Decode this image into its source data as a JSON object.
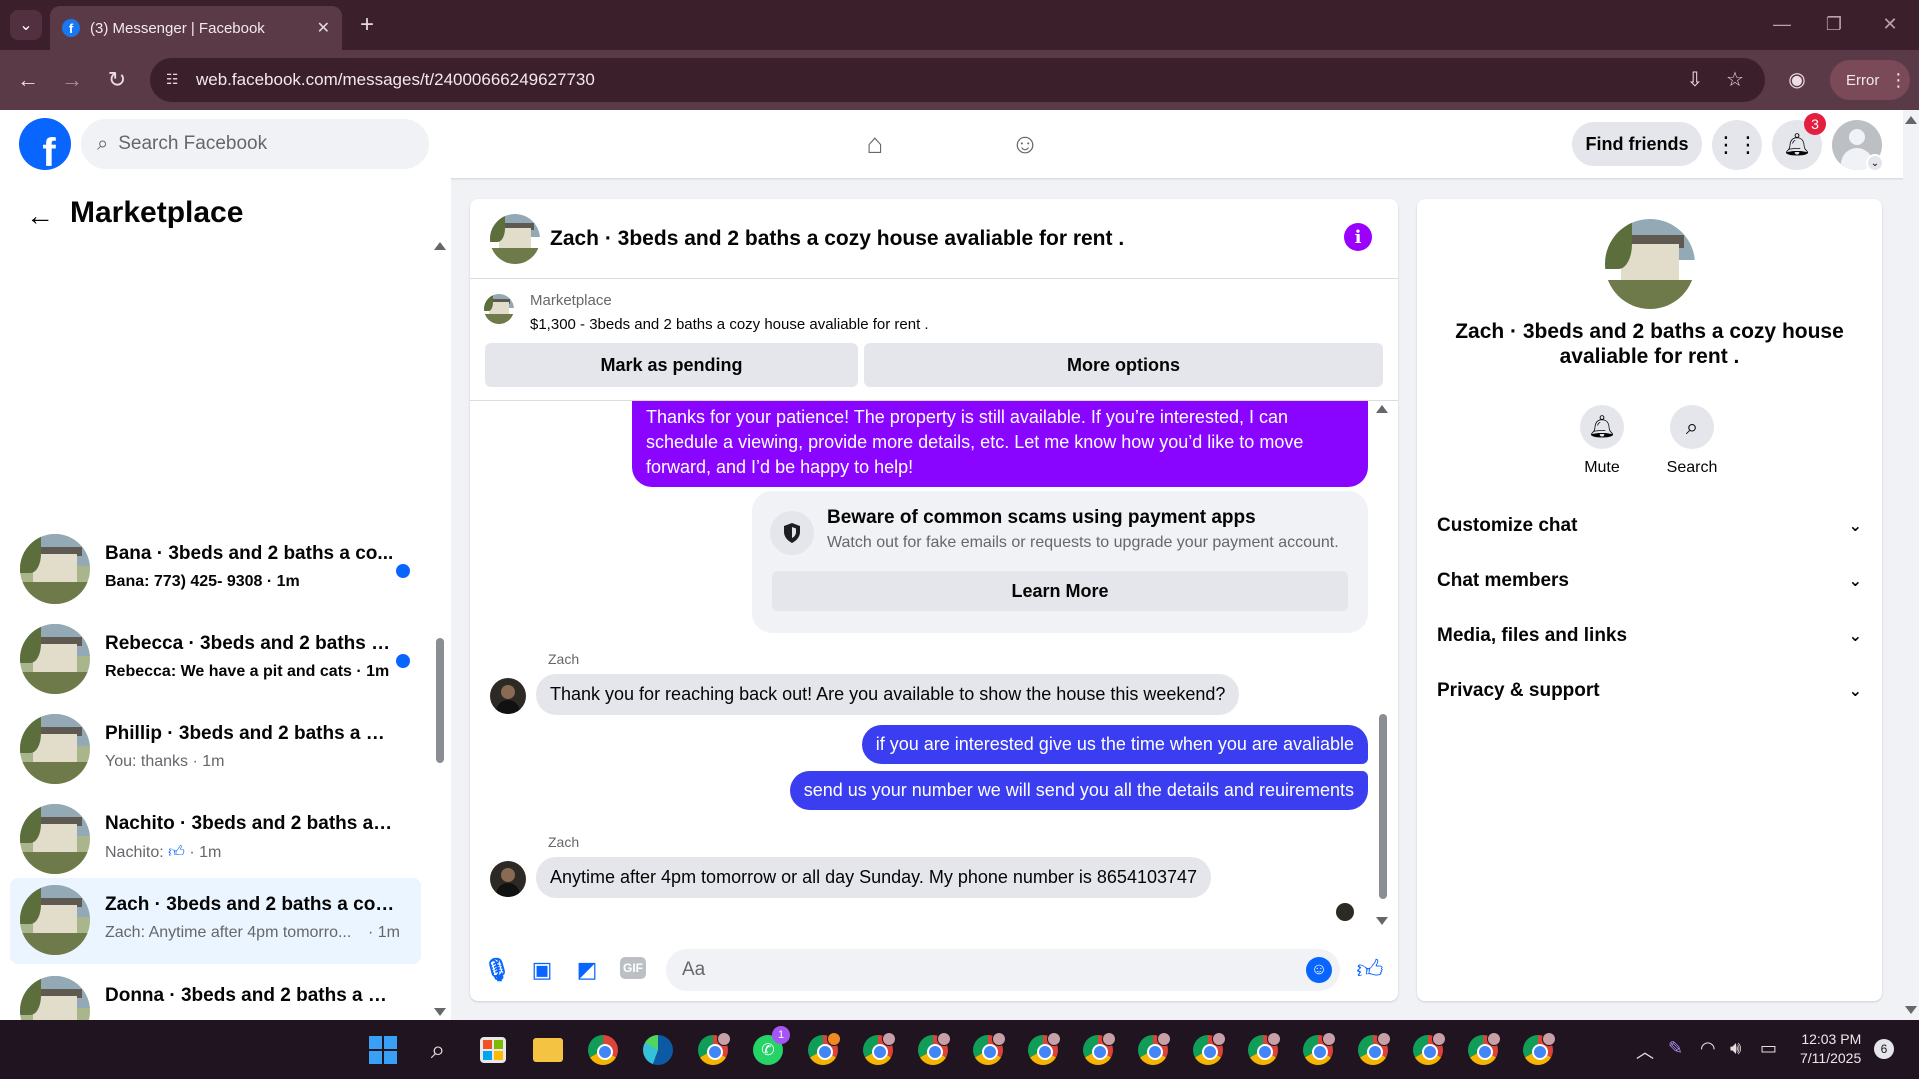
{
  "browser": {
    "tab_title": "(3) Messenger | Facebook",
    "url": "web.facebook.com/messages/t/24000666249627730",
    "error_label": "Error"
  },
  "header": {
    "search_placeholder": "Search Facebook",
    "find_friends": "Find friends",
    "notification_count": "3"
  },
  "sidebar": {
    "title": "Marketplace",
    "conversations": [
      {
        "name": "Bana · 3beds and 2 baths a co...",
        "preview": "Bana: 773) 425- 9308 · 1m",
        "unread": true
      },
      {
        "name": "Rebecca · 3beds and 2 baths a ...",
        "preview": "Rebecca: We have a pit and cats · 1m",
        "unread": true
      },
      {
        "name": "Phillip · 3beds and 2 baths a coz...",
        "preview": "You: thanks · 1m",
        "unread": false
      },
      {
        "name": "Nachito · 3beds and 2 baths a c...",
        "preview_prefix": "Nachito:",
        "preview_suffix": "· 1m",
        "unread": false
      },
      {
        "name": "Zach · 3beds and 2 baths a cozy ...",
        "preview": "Zach: Anytime after 4pm tomorro...",
        "time": "· 1m",
        "unread": false,
        "active": true
      },
      {
        "name": "Donna · 3beds and 2 baths a coz...",
        "preview": "",
        "unread": false
      }
    ]
  },
  "chat": {
    "title": "Zach · 3beds and 2 baths a cozy house avaliable for rent .",
    "listing_label": "Marketplace",
    "listing_desc": "$1,300 - 3beds and 2 baths a cozy house avaliable for rent .",
    "mark_pending": "Mark as pending",
    "more_options": "More options",
    "msg_patience": "Thanks for your patience! The property is still available. If you’re interested, I can schedule a viewing, provide more details, etc. Let me know how you’d like to move forward, and I’d be happy to help!",
    "warning_title": "Beware of common scams using payment apps",
    "warning_text": "Watch out for fake emails or requests to upgrade your payment account.",
    "learn_more": "Learn More",
    "sender": "Zach",
    "msg_in_1": "Thank you for reaching back out! Are you available to show the house this weekend?",
    "msg_out_1": "if you  are interested give us the time when you are avaliable",
    "msg_out_2": "send us your number we will send you all  the details and reuirements",
    "msg_in_2": "Anytime after 4pm tomorrow or all day Sunday. My phone number is 8654103747",
    "composer_placeholder": "Aa"
  },
  "info_panel": {
    "name": "Zach · 3beds and 2 baths a cozy house avaliable for rent .",
    "mute": "Mute",
    "search": "Search",
    "rows": [
      "Customize chat",
      "Chat members",
      "Media, files and links",
      "Privacy & support"
    ]
  },
  "taskbar": {
    "time": "12:03 PM",
    "date": "7/11/2025",
    "whatsapp_badge": "1",
    "notification_count": "6"
  },
  "colors": {
    "outgoing_purple": "#8a05ff",
    "outgoing_blue": "#3a3ef0",
    "fb_blue": "#0866ff"
  }
}
